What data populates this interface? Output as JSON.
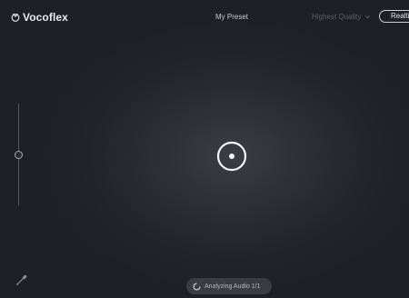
{
  "app": {
    "name": "Vocoflex",
    "preset_name": "My Preset",
    "quality": "Highest Quality",
    "realtime_label": "Realti"
  },
  "slider": {
    "level": 0.5
  },
  "status": {
    "text": "Analyzing Audio 1/1"
  },
  "icons": {
    "logo": "vocoflex-logo-icon",
    "quality_dropdown": "chevron-down-icon",
    "center": "target-icon",
    "tool": "eyedropper-icon",
    "spinner": "spinner-icon"
  },
  "colors": {
    "background": "#24252b",
    "glow": "#3b3d44",
    "text": "#e9eaee",
    "muted": "#5c5e66",
    "pill": "#3a3c43"
  }
}
